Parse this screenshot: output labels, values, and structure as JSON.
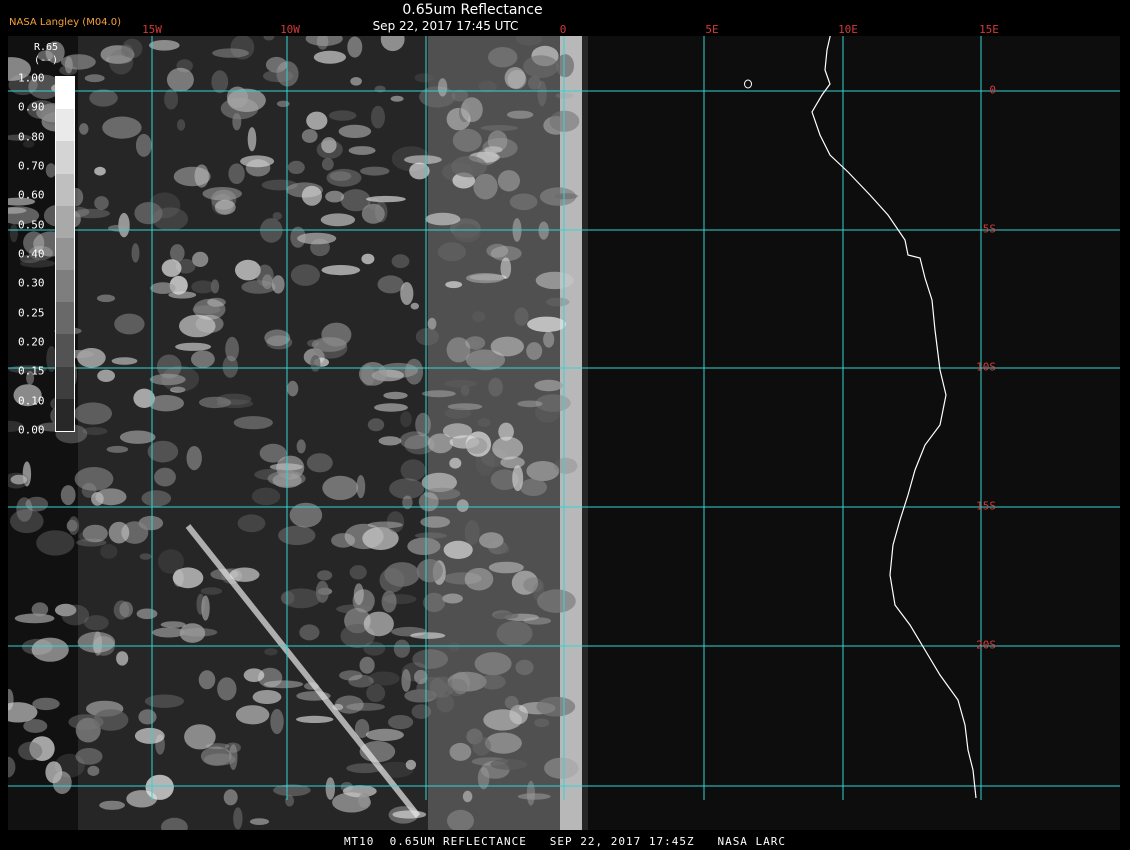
{
  "header": {
    "title": "0.65um Reflectance",
    "subtitle": "Sep 22, 2017 17:45 UTC",
    "credit": "NASA Langley (M04.0)"
  },
  "legend": {
    "name": "R.65",
    "units": "(--)",
    "ticks": [
      "1.00",
      "0.90",
      "0.80",
      "0.70",
      "0.60",
      "0.50",
      "0.40",
      "0.30",
      "0.25",
      "0.20",
      "0.15",
      "0.10",
      "0.00"
    ]
  },
  "map": {
    "longitude_labels": [
      "15W",
      "10W",
      "0",
      "5E",
      "10E",
      "15E"
    ],
    "latitude_labels": [
      "0",
      "5S",
      "10S",
      "15S",
      "20S"
    ],
    "grid_color": "#35d4d4",
    "label_color": "#d23a3a",
    "coastline_color": "#ffffff"
  },
  "footer": {
    "caption": "MT10  0.65UM REFLECTANCE   SEP 22, 2017 17:45Z   NASA LARC"
  }
}
